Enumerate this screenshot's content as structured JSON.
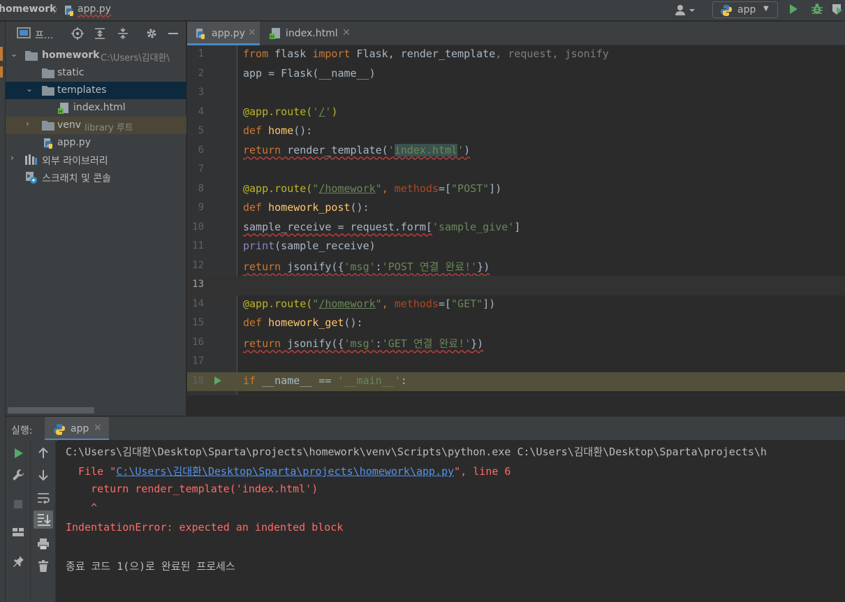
{
  "breadcrumb": {
    "project": "homework",
    "file": "app.py"
  },
  "toolbar": {
    "run_config": "app"
  },
  "project_panel": {
    "title": "프...",
    "tree": [
      {
        "label": "homework",
        "hint": "C:\\Users\\김대환\\"
      },
      {
        "label": "static"
      },
      {
        "label": "templates"
      },
      {
        "label": "index.html"
      },
      {
        "label": "venv",
        "hint": "library 루트"
      },
      {
        "label": "app.py"
      },
      {
        "label": "외부 라이브러리"
      },
      {
        "label": "스크래치 및 콘솔"
      }
    ]
  },
  "editor": {
    "tabs": [
      {
        "label": "app.py"
      },
      {
        "label": "index.html"
      }
    ],
    "line_numbers": [
      "1",
      "2",
      "3",
      "4",
      "5",
      "6",
      "7",
      "8",
      "9",
      "10",
      "11",
      "12",
      "13",
      "14",
      "15",
      "16",
      "17",
      "18"
    ],
    "tokens": {
      "l1": [
        "from",
        " flask ",
        "import",
        " Flask, render_template",
        ", ",
        "request",
        ", ",
        "jsonify"
      ],
      "l2": [
        "app = Flask(__name__)"
      ],
      "l4": [
        "@app.route(",
        "'",
        "/",
        "'",
        ")"
      ],
      "l5": [
        "def",
        " ",
        "home",
        "():"
      ],
      "l6": [
        "return",
        " render_template(",
        "'",
        "index.html",
        "'",
        ")"
      ],
      "l8": [
        "@app.route(",
        "\"",
        "/homework",
        "\"",
        ", ",
        "methods",
        "=[",
        "\"POST\"",
        "])"
      ],
      "l9": [
        "def",
        " ",
        "homework_post",
        "():"
      ],
      "l10": [
        "sample_receive = request.form[",
        "'sample_give'",
        "]"
      ],
      "l11": [
        "print",
        "(sample_receive)"
      ],
      "l12": [
        "return",
        " jsonify({",
        "'msg'",
        ":",
        "'POST 연결 완료!'",
        "})"
      ],
      "l14": [
        "@app.route(",
        "\"",
        "/homework",
        "\"",
        ", ",
        "methods",
        "=[",
        "\"GET\"",
        "])"
      ],
      "l15": [
        "def",
        " ",
        "homework_get",
        "():"
      ],
      "l16": [
        "return",
        " jsonify({",
        "'msg'",
        ":",
        "'GET 연결 완료!'",
        "})"
      ],
      "l18": [
        "if",
        " __name__ == ",
        "'__main__'",
        ":"
      ]
    }
  },
  "run_panel": {
    "label": "실행:",
    "tab_label": "app",
    "console": {
      "cmd": "C:\\Users\\김대환\\Desktop\\Sparta\\projects\\homework\\venv\\Scripts\\python.exe C:\\Users\\김대환\\Desktop\\Sparta\\projects\\h",
      "file_prefix": "  File \"",
      "file_link": "C:\\Users\\김대환\\Desktop\\Sparta\\projects\\homework\\app.py",
      "file_suffix": "\", line 6",
      "code_line": "    return render_template('index.html')",
      "caret": "    ^",
      "error": "IndentationError: expected an indented block",
      "exit": "종료 코드 1(으)로 완료된 프로세스"
    }
  },
  "colors": {
    "background": "#2b2b2b",
    "panel": "#3c3f41",
    "keyword": "#cc7832",
    "string": "#6a8759",
    "function": "#ffc66d",
    "decorator": "#bbb529",
    "error_text": "#ff6b68",
    "link": "#5394ec",
    "accent": "#4a88c7"
  },
  "icons": [
    "python-file-icon",
    "user-icon",
    "run-icon",
    "debug-icon",
    "coverage-icon",
    "project-view-icon",
    "locate-icon",
    "expand-all-icon",
    "collapse-all-icon",
    "gear-icon",
    "minimize-icon",
    "folder-icon",
    "html-file-icon",
    "library-icon",
    "scratch-icon",
    "up-arrow-icon",
    "down-arrow-icon",
    "soft-wrap-icon",
    "scroll-to-end-icon",
    "print-icon",
    "trash-icon",
    "wrench-icon",
    "stop-icon",
    "layout-icon",
    "pin-icon"
  ]
}
